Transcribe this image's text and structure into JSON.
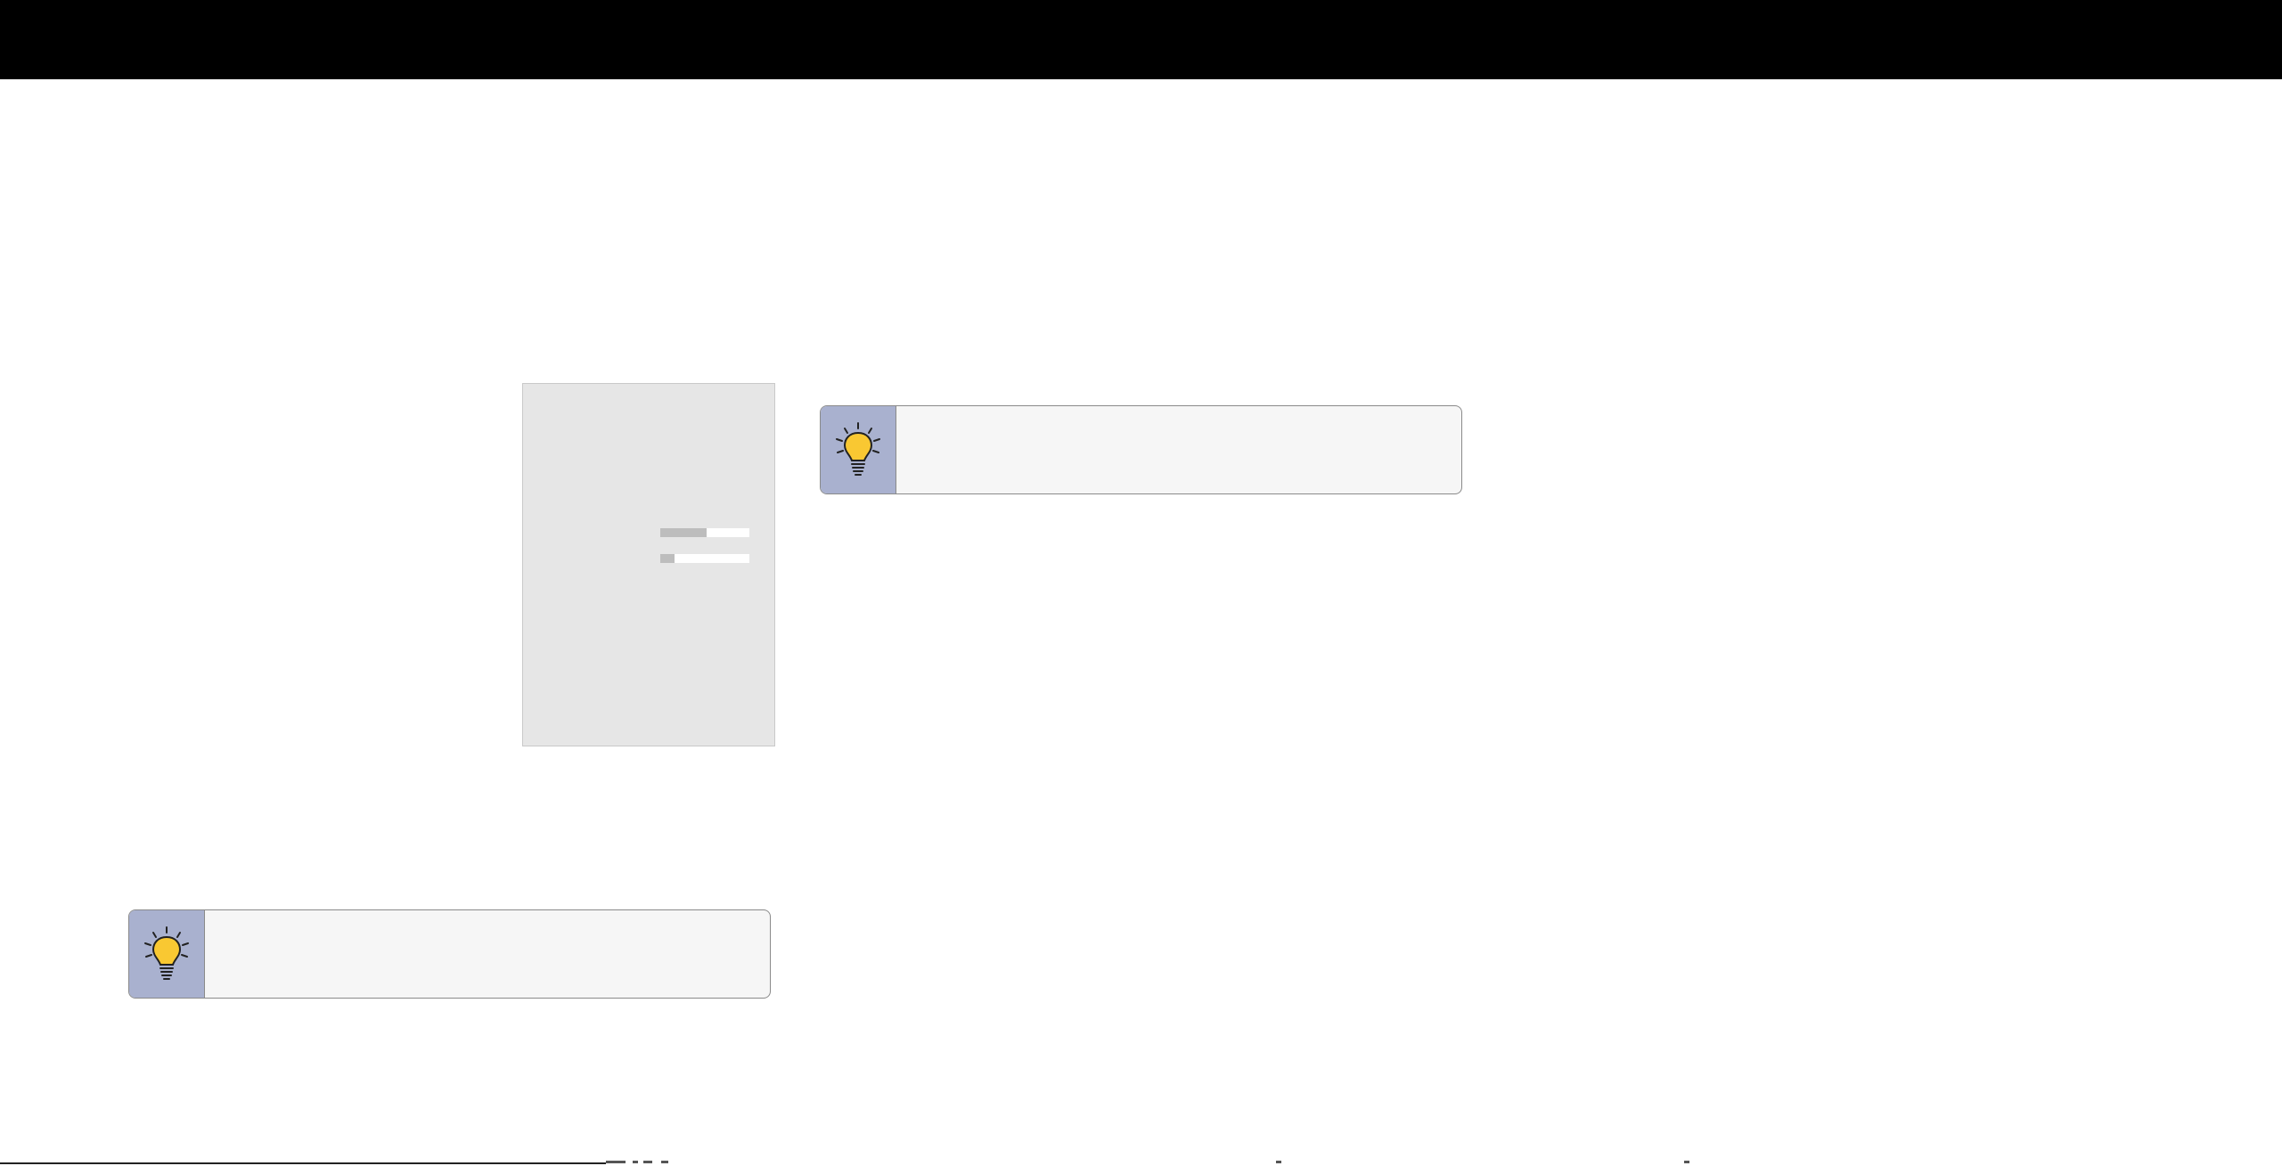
{
  "header": {
    "bar_color": "#000000"
  },
  "settings_panel": {
    "sliders": [
      {
        "name": "slider-1",
        "level_percent": 52
      },
      {
        "name": "slider-2",
        "level_percent": 16
      }
    ]
  },
  "tips": [
    {
      "icon": "lightbulb-icon",
      "text": ""
    },
    {
      "icon": "lightbulb-icon",
      "text": ""
    }
  ],
  "colors": {
    "tip_icon_bg": "#a9b1cf",
    "tip_bg": "#f6f6f6",
    "bulb": "#f9c832",
    "panel_bg": "#e6e6e6"
  }
}
